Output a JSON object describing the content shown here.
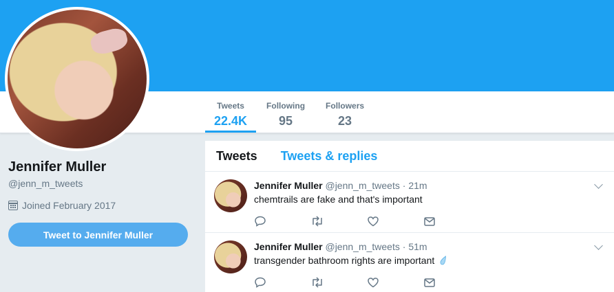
{
  "profile": {
    "name": "Jennifer Muller",
    "handle": "@jenn_m_tweets",
    "joined": "Joined February 2017",
    "tweet_to_label": "Tweet to Jennifer Muller"
  },
  "stats": [
    {
      "label": "Tweets",
      "value": "22.4K"
    },
    {
      "label": "Following",
      "value": "95"
    },
    {
      "label": "Followers",
      "value": "23"
    }
  ],
  "timeline": {
    "tabs": [
      "Tweets",
      "Tweets & replies"
    ],
    "tweets": [
      {
        "name": "Jennifer Muller",
        "handle": "@jenn_m_tweets",
        "separator": "·",
        "time": "21m",
        "text": "chemtrails are fake and that's important"
      },
      {
        "name": "Jennifer Muller",
        "handle": "@jenn_m_tweets",
        "separator": "·",
        "time": "51m",
        "text": "transgender bathroom rights are important"
      }
    ]
  },
  "icons": {
    "reply": "reply-icon",
    "retweet": "retweet-icon",
    "like": "heart-icon",
    "message": "envelope-icon",
    "calendar": "calendar-icon",
    "caret": "chevron-down-icon",
    "emoji": "droplet-icon"
  },
  "colors": {
    "accent": "#1da1f2",
    "button": "#55acee",
    "background": "#e6ecf0",
    "muted": "#657786"
  }
}
